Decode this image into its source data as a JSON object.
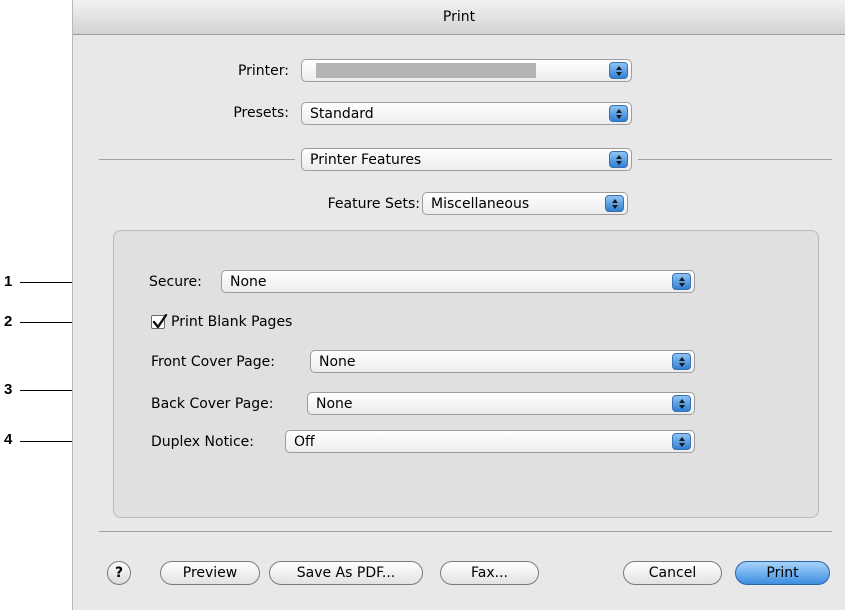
{
  "window": {
    "title": "Print"
  },
  "printer": {
    "label": "Printer:",
    "value": ""
  },
  "presets": {
    "label": "Presets:",
    "value": "Standard"
  },
  "pane_menu": {
    "value": "Printer Features"
  },
  "feature_sets": {
    "label": "Feature Sets:",
    "value": "Miscellaneous"
  },
  "options": {
    "secure": {
      "label": "Secure:",
      "value": "None"
    },
    "print_blank_pages": {
      "label": "Print Blank Pages",
      "checked": true
    },
    "front_cover": {
      "label": "Front Cover Page:",
      "value": "None"
    },
    "back_cover": {
      "label": "Back Cover Page:",
      "value": "None"
    },
    "duplex_notice": {
      "label": "Duplex Notice:",
      "value": "Off"
    }
  },
  "buttons": {
    "help": "?",
    "preview": "Preview",
    "save_pdf": "Save As PDF...",
    "fax": "Fax...",
    "cancel": "Cancel",
    "print": "Print"
  },
  "callouts": [
    "1",
    "2",
    "3",
    "4"
  ],
  "colors": {
    "accent": "#3d8ee0",
    "window_bg": "#e8e8e8"
  }
}
